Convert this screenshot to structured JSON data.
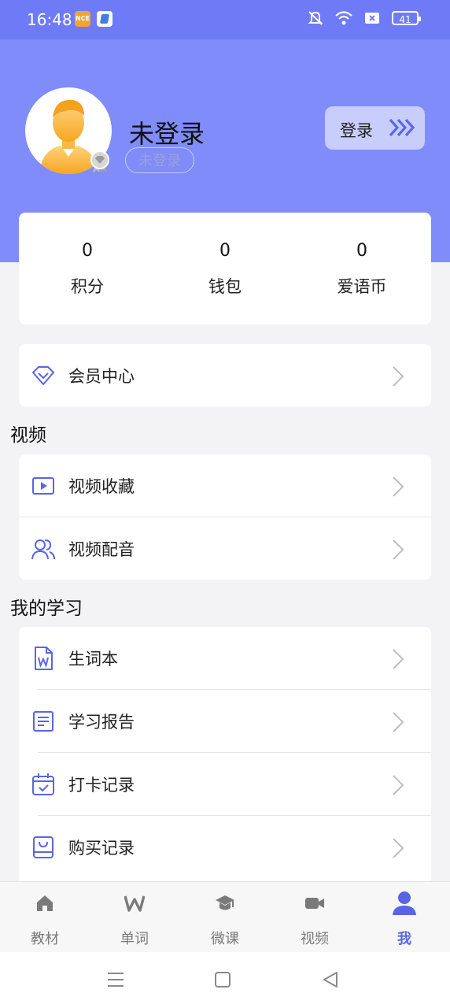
{
  "status_bar": {
    "time": "16:48",
    "app1": "NCE",
    "battery": "41"
  },
  "profile": {
    "username": "未登录",
    "badge": "未登录",
    "login_label": "登录"
  },
  "stats": [
    {
      "value": "0",
      "label": "积分"
    },
    {
      "value": "0",
      "label": "钱包"
    },
    {
      "value": "0",
      "label": "爱语币"
    }
  ],
  "member": {
    "label": "会员中心",
    "icon": "diamond-icon"
  },
  "video_section": {
    "title": "视频",
    "items": [
      {
        "label": "视频收藏",
        "icon": "video-play-icon"
      },
      {
        "label": "视频配音",
        "icon": "users-icon"
      }
    ]
  },
  "study_section": {
    "title": "我的学习",
    "items": [
      {
        "label": "生词本",
        "icon": "word-doc-icon"
      },
      {
        "label": "学习报告",
        "icon": "report-icon"
      },
      {
        "label": "打卡记录",
        "icon": "calendar-check-icon"
      },
      {
        "label": "购买记录",
        "icon": "shopping-bag-icon"
      }
    ]
  },
  "tabs": [
    {
      "label": "教材",
      "icon": "home-icon",
      "active": false
    },
    {
      "label": "单词",
      "icon": "w-letter-icon",
      "active": false
    },
    {
      "label": "微课",
      "icon": "graduation-cap-icon",
      "active": false
    },
    {
      "label": "视频",
      "icon": "video-camera-icon",
      "active": false
    },
    {
      "label": "我",
      "icon": "person-icon",
      "active": true
    }
  ],
  "colors": {
    "header": "#7f8cf9",
    "accent": "#5866e6",
    "status_bar": "#6f7bf6"
  }
}
